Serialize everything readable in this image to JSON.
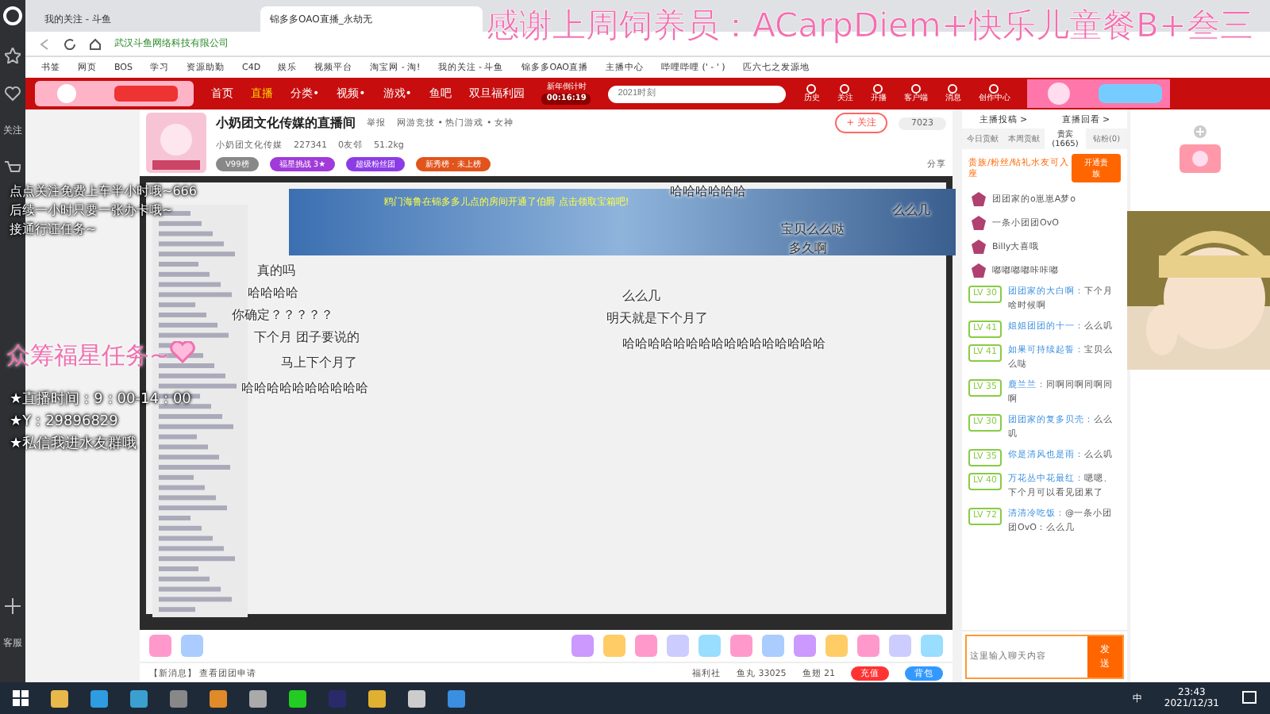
{
  "browser": {
    "tabs": [
      {
        "label": "我的关注 - 斗鱼",
        "selected": false
      },
      {
        "label": "锦多多OAO直播_永劫无",
        "selected": true
      }
    ],
    "address": "武汉斗鱼网络科技有限公司",
    "bookmarks": [
      "书签",
      "网页",
      "BOS",
      "学习",
      "资源助勤",
      "C4D",
      "娱乐",
      "视频平台",
      "淘宝网 - 淘!",
      "我的关注 - 斗鱼",
      "锦多多OAO直播",
      "主播中心",
      "哔哩哔哩 (' - ' )",
      "匹六七之发源地"
    ]
  },
  "thanks_banner": "感谢上周饲养员：ACarpDiem+快乐儿童餐B+叁三",
  "left_rail": {
    "follow_label": "关注",
    "service_label": "客服"
  },
  "site_nav": {
    "items": [
      {
        "label": "首页",
        "selected": false
      },
      {
        "label": "直播",
        "selected": true
      },
      {
        "label": "分类•",
        "selected": false
      },
      {
        "label": "视频•",
        "selected": false
      },
      {
        "label": "游戏•",
        "selected": false
      },
      {
        "label": "鱼吧",
        "selected": false
      },
      {
        "label": "双旦福利园",
        "selected": false
      }
    ],
    "countdown_label": "新年倒计时",
    "countdown": "00:16:19",
    "search_placeholder": "2021时刻",
    "actions": [
      "历史",
      "关注",
      "开播",
      "客户端",
      "消息",
      "创作中心"
    ]
  },
  "room": {
    "title": "小奶团文化传媒的直播间",
    "report": "举报",
    "category": "网游竞技 • 热门游戏 • 女神",
    "anchor": "小奶团文化传媒",
    "hot": "227341",
    "friends": "0友邻",
    "weight": "51.2kg",
    "badges": [
      "V99榜",
      "福星挑战 3★",
      "超级粉丝团",
      "新秀榜 · 未上榜"
    ],
    "follow": "+ 关注",
    "follow_count": "7023",
    "share": "分享"
  },
  "stream": {
    "notice": [
      "点点关注免费上车半小时哦~666",
      "后续一小时只要一张办卡哦~",
      "接通行证任务~"
    ],
    "task": "众筹福星任务~",
    "info": [
      "★直播时间：9：00-14：00",
      "★Y：29896829",
      "★私信我进水友群哦"
    ],
    "danmaku": [
      "哈哈哈哈哈哈",
      "么么几",
      "宝贝么么哒",
      "多久啊",
      "真的吗",
      "哈哈哈哈",
      "么么几",
      "你确定？？？？？",
      "明天就是下个月了",
      "下个月 团子要说的",
      "哈哈哈哈哈哈哈哈哈哈哈哈哈哈哈哈",
      "马上下个月了",
      "哈哈哈哈哈哈哈哈哈哈"
    ],
    "announcement": "鸥门海鲁在锦多多儿点的房间开通了伯爵 点击领取宝箱吧!",
    "gift_bar": {
      "welfare": "福利社",
      "fish_ball": "鱼丸 33025",
      "fish_fin": "鱼翅 21",
      "recharge": "充值",
      "backpack": "背包",
      "message": "【新消息】 查看团团申请"
    }
  },
  "side": {
    "links": [
      "主播投稿 >",
      "直播回看 >"
    ],
    "tabs": [
      {
        "label": "今日贡献",
        "selected": false
      },
      {
        "label": "本周贡献",
        "selected": false
      },
      {
        "label": "贵宾(1665)",
        "selected": true
      },
      {
        "label": "钻粉(0)",
        "selected": false
      }
    ],
    "seat_note": "贵族/粉丝/钻礼水友可入座",
    "open_button": "开通贵族",
    "vips": [
      "团团家的o崽崽A梦o",
      "一条小团团OvO",
      "Billy大喜哦",
      "嘟嘟嘟嘟咔咔嘟"
    ],
    "chat": [
      {
        "level": "LV 30",
        "name": "团团家的大白啊：",
        "text": "下个月啥时候啊"
      },
      {
        "level": "LV 41",
        "name": "姐姐团团的十一：",
        "text": "么么叽"
      },
      {
        "level": "LV 41",
        "name": "如果可持续起誓：",
        "text": "宝贝么么哒"
      },
      {
        "level": "LV 35",
        "name": "鹿兰兰：",
        "text": "同啊同啊同啊同啊"
      },
      {
        "level": "LV 30",
        "name": "团团家的复多贝壳：",
        "text": "么么叽"
      },
      {
        "level": "LV 35",
        "name": "你是清风也是雨：",
        "text": "么么叽"
      },
      {
        "level": "LV 40",
        "name": "万花丛中花最红：",
        "text": "嗯嗯、下个月可以看见团累了"
      },
      {
        "level": "LV 72",
        "name": "清清冷吃饭：",
        "text": "@一条小团团OvO：么么几"
      }
    ],
    "input_placeholder": "这里输入聊天内容",
    "send": "发送"
  },
  "taskbar": {
    "ime": "中",
    "time": "23:43",
    "date": "2021/12/31"
  }
}
